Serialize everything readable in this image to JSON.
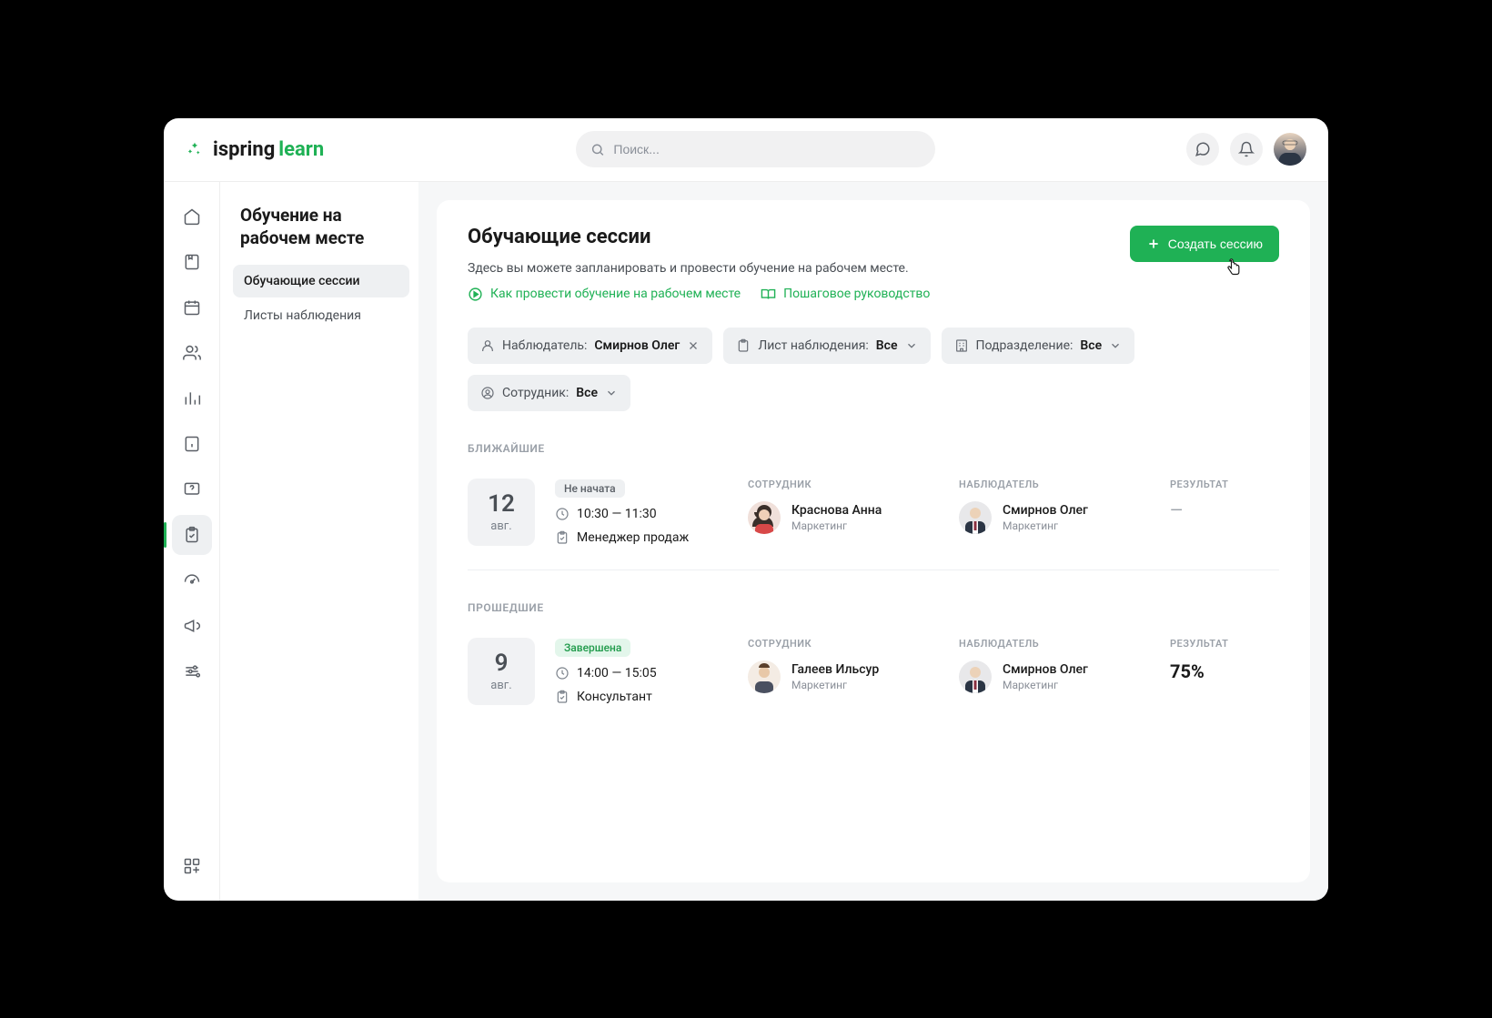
{
  "header": {
    "logo_ispring": "ispring",
    "logo_learn": "learn",
    "search_placeholder": "Поиск..."
  },
  "side_panel": {
    "title": "Обучение на рабочем месте",
    "items": [
      {
        "label": "Обучающие сессии",
        "active": true
      },
      {
        "label": "Листы наблюдения",
        "active": false
      }
    ]
  },
  "main": {
    "title": "Обучающие сессии",
    "subtitle": "Здесь вы можете запланировать и провести обучение на рабочем месте.",
    "link1": "Как провести обучение на рабочем месте",
    "link2": "Пошаговое руководство",
    "create_button": "Создать сессию"
  },
  "filters": {
    "observer_label": "Наблюдатель:",
    "observer_value": "Смирнов Олег",
    "sheet_label": "Лист наблюдения:",
    "sheet_value": "Все",
    "department_label": "Подразделение:",
    "department_value": "Все",
    "employee_label": "Сотрудник:",
    "employee_value": "Все"
  },
  "sections": {
    "upcoming_label": "БЛИЖАЙШИЕ",
    "past_label": "ПРОШЕДШИЕ",
    "col_employee": "СОТРУДНИК",
    "col_observer": "НАБЛЮДАТЕЛЬ",
    "col_result": "РЕЗУЛЬТАТ"
  },
  "sessions": {
    "upcoming": {
      "day": "12",
      "month": "авг.",
      "status": "Не начата",
      "time": "10:30 — 11:30",
      "sheet": "Менеджер продаж",
      "employee_name": "Краснова Анна",
      "employee_dept": "Маркетинг",
      "observer_name": "Смирнов Олег",
      "observer_dept": "Маркетинг",
      "result": "—"
    },
    "past": {
      "day": "9",
      "month": "авг.",
      "status": "Завершена",
      "time": "14:00 — 15:05",
      "sheet": "Консультант",
      "employee_name": "Галеев Ильсур",
      "employee_dept": "Маркетинг",
      "observer_name": "Смирнов Олег",
      "observer_dept": "Маркетинг",
      "result": "75%"
    }
  }
}
